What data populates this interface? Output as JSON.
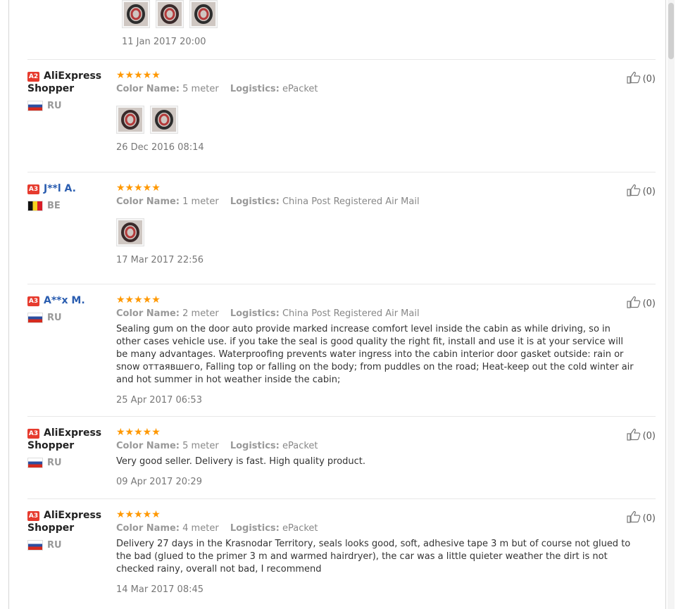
{
  "top_tail": {
    "image_count": 3,
    "date": "11 Jan 2017 20:00"
  },
  "reviews": [
    {
      "level": "A2",
      "name": "AliExpress Shopper",
      "name_style": "plain",
      "country": "RU",
      "flag": "ru",
      "stars": "★★★★★",
      "color_label": "Color Name:",
      "color_value": "5 meter",
      "logistics_label": "Logistics:",
      "logistics_value": "ePacket",
      "text": "",
      "images": 2,
      "date": "26 Dec 2016 08:14",
      "likes": "(0)"
    },
    {
      "level": "A3",
      "name": "J**l A.",
      "name_style": "link",
      "country": "BE",
      "flag": "be",
      "stars": "★★★★★",
      "color_label": "Color Name:",
      "color_value": "1 meter",
      "logistics_label": "Logistics:",
      "logistics_value": "China Post Registered Air Mail",
      "text": "",
      "images": 1,
      "date": "17 Mar 2017 22:56",
      "likes": "(0)"
    },
    {
      "level": "A3",
      "name": "A**x M.",
      "name_style": "link",
      "country": "RU",
      "flag": "ru",
      "stars": "★★★★★",
      "color_label": "Color Name:",
      "color_value": "2 meter",
      "logistics_label": "Logistics:",
      "logistics_value": "China Post Registered Air Mail",
      "text": "Sealing gum on the door auto provide marked increase comfort level inside the cabin as while driving, so in other cases vehicle use. if you take the seal is good quality the right fit, install and use it is at your service will be many advantages. Waterproofing prevents water ingress into the cabin interior door gasket outside: rain or snow оттаявшего, Falling top or falling on the body; from puddles on the road; Heat-keep out the cold winter air and hot summer in hot weather inside the cabin;",
      "images": 0,
      "date": "25 Apr 2017 06:53",
      "likes": "(0)"
    },
    {
      "level": "A3",
      "name": "AliExpress Shopper",
      "name_style": "plain",
      "country": "RU",
      "flag": "ru",
      "stars": "★★★★★",
      "color_label": "Color Name:",
      "color_value": "5 meter",
      "logistics_label": "Logistics:",
      "logistics_value": "ePacket",
      "text": "Very good seller. Delivery is fast. High quality product.",
      "images": 0,
      "date": "09 Apr 2017 20:29",
      "likes": "(0)"
    },
    {
      "level": "A3",
      "name": "AliExpress Shopper",
      "name_style": "plain",
      "country": "RU",
      "flag": "ru",
      "stars": "★★★★★",
      "color_label": "Color Name:",
      "color_value": "4 meter",
      "logistics_label": "Logistics:",
      "logistics_value": "ePacket",
      "text": "Delivery 27 days in the Krasnodar Territory, seals looks good, soft, adhesive tape 3 m but of course not glued to the bad (glued to the primer 3 m and warmed hairdryer), the car was a little quieter weather the dirt is not checked rainy, overall not bad, I recommend",
      "images": 0,
      "date": "14 Mar 2017 08:45",
      "likes": "(0)"
    }
  ],
  "colors": {
    "star": "#ff9800",
    "level_badge": "#e63b2e",
    "link": "#2a5db0"
  },
  "icons": {
    "like": "thumbs-up-icon"
  }
}
